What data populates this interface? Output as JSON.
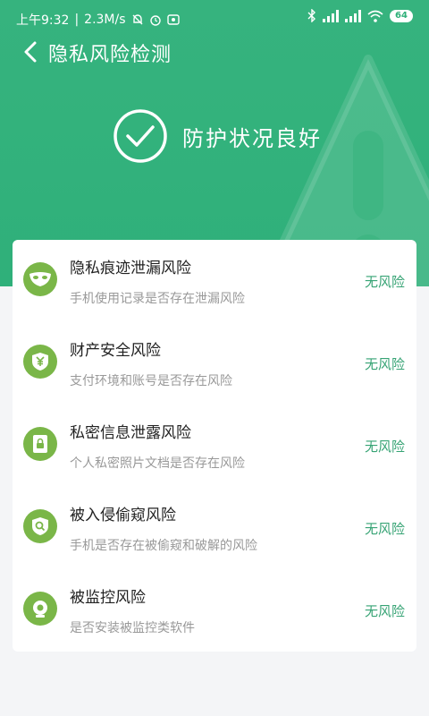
{
  "status_bar": {
    "time": "上午9:32",
    "speed": "2.3M/s",
    "battery": "64"
  },
  "header": {
    "title": "隐私风险检测",
    "status_text": "防护状况良好"
  },
  "items": [
    {
      "icon": "mask-icon",
      "title": "隐私痕迹泄漏风险",
      "desc": "手机使用记录是否存在泄漏风险",
      "status": "无风险"
    },
    {
      "icon": "yuan-shield-icon",
      "title": "财产安全风险",
      "desc": "支付环境和账号是否存在风险",
      "status": "无风险"
    },
    {
      "icon": "lock-document-icon",
      "title": "私密信息泄露风险",
      "desc": "个人私密照片文档是否存在风险",
      "status": "无风险"
    },
    {
      "icon": "search-shield-icon",
      "title": "被入侵偷窥风险",
      "desc": "手机是否存在被偷窥和破解的风险",
      "status": "无风险"
    },
    {
      "icon": "camera-icon",
      "title": "被监控风险",
      "desc": "是否安装被监控类软件",
      "status": "无风险"
    }
  ],
  "colors": {
    "header_green": "#36b37e",
    "icon_green": "#7ab648",
    "status_green": "#36a374"
  }
}
